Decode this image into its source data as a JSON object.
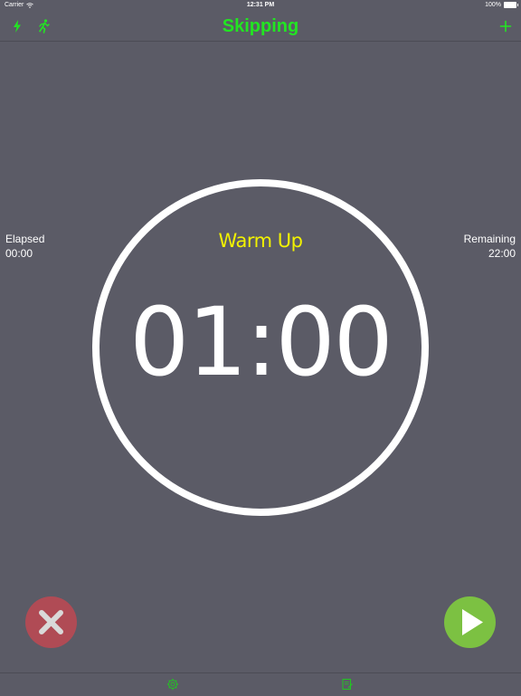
{
  "status_bar": {
    "carrier": "Carrier",
    "time": "12:31 PM",
    "battery": "100%"
  },
  "nav": {
    "title": "Skipping",
    "left_icons": [
      "lightning-icon",
      "runner-icon"
    ],
    "right_icon": "plus-icon"
  },
  "elapsed": {
    "label": "Elapsed",
    "value": "00:00"
  },
  "remaining": {
    "label": "Remaining",
    "value": "22:00"
  },
  "timer": {
    "phase": "Warm Up",
    "display": "01:00"
  },
  "controls": {
    "stop_icon": "x-icon",
    "play_icon": "play-icon"
  },
  "tabs": [
    "settings-gear-icon",
    "notes-edit-icon"
  ],
  "colors": {
    "background": "#5b5b66",
    "accent_green": "#22e522",
    "phase_yellow": "#f2f200",
    "stop_red": "#b04b55",
    "play_green": "#7cc142"
  }
}
